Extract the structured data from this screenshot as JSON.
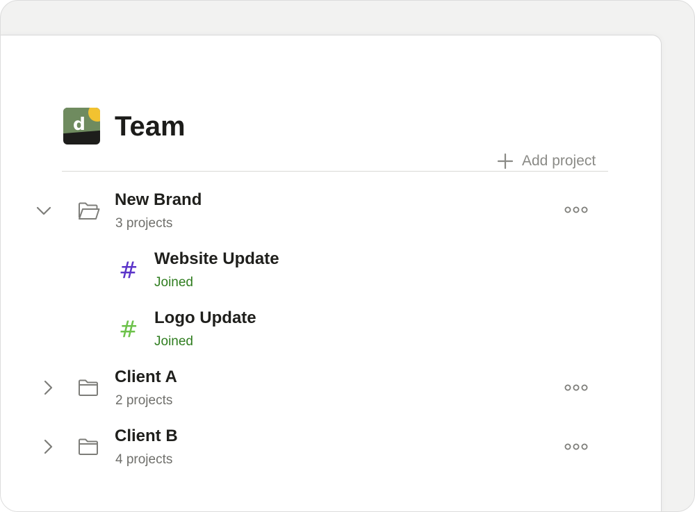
{
  "header": {
    "logo_letter": "d",
    "title": "Team",
    "add_project_label": "Add project"
  },
  "groups": [
    {
      "name": "New Brand",
      "count_label": "3 projects",
      "expanded": true,
      "projects": [
        {
          "name": "Website Update",
          "status": "Joined",
          "hash_color": "#5b34c9"
        },
        {
          "name": "Logo Update",
          "status": "Joined",
          "hash_color": "#6cc24a"
        }
      ]
    },
    {
      "name": "Client A",
      "count_label": "2 projects",
      "expanded": false
    },
    {
      "name": "Client B",
      "count_label": "4 projects",
      "expanded": false
    }
  ],
  "icons": {
    "hash_glyph": "#",
    "add": "plus-icon",
    "expanded": "chevron-down-icon",
    "collapsed": "chevron-right-icon",
    "open_folder": "folder-open-icon",
    "folder": "folder-icon",
    "more": "more-options-icon"
  },
  "colors": {
    "joined": "#2f7d1f",
    "logo_green": "#6f8b5f",
    "logo_yellow": "#f2c230",
    "logo_dark": "#1d1d1b"
  }
}
